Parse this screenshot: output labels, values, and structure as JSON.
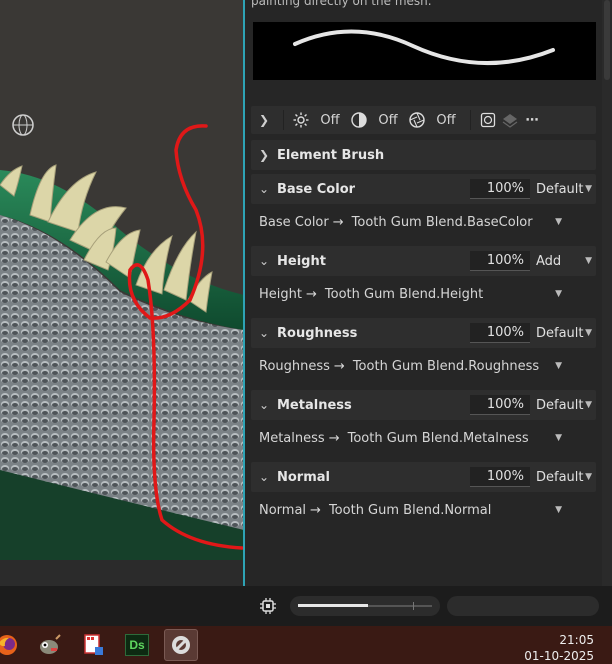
{
  "panel": {
    "hint_text": "painting directly on the mesh.",
    "toolbar": {
      "brightness_state": "Off",
      "contrast_state": "Off",
      "aperture_state": "Off",
      "more_label": "⋯"
    },
    "element_brush_label": "Element Brush",
    "channels": [
      {
        "name": "Base Color",
        "opacity": "100%",
        "blend": "Default",
        "source": "Base Color",
        "target": "Tooth Gum Blend.BaseColor"
      },
      {
        "name": "Height",
        "opacity": "100%",
        "blend": "Add",
        "source": "Height",
        "target": "Tooth Gum Blend.Height"
      },
      {
        "name": "Roughness",
        "opacity": "100%",
        "blend": "Default",
        "source": "Roughness",
        "target": "Tooth Gum Blend.Roughness"
      },
      {
        "name": "Metalness",
        "opacity": "100%",
        "blend": "Default",
        "source": "Metalness",
        "target": "Tooth Gum Blend.Metalness"
      },
      {
        "name": "Normal",
        "opacity": "100%",
        "blend": "Default",
        "source": "Normal",
        "target": "Tooth Gum Blend.Normal"
      }
    ]
  },
  "bottom_bar": {
    "zoom_fill_fraction": 0.52
  },
  "taskbar": {
    "apps": [
      "firefox-icon",
      "gimp-icon",
      "media-app-icon",
      "substance-designer-icon",
      "substance-painter-icon"
    ],
    "ds_label": "Ds",
    "time": "21:05",
    "date": "01-10-2025"
  },
  "colors": {
    "accent": "#2ea3b5",
    "gum": "#1f6b45",
    "tooth": "#dcd6a8",
    "annotation": "#e01818"
  }
}
